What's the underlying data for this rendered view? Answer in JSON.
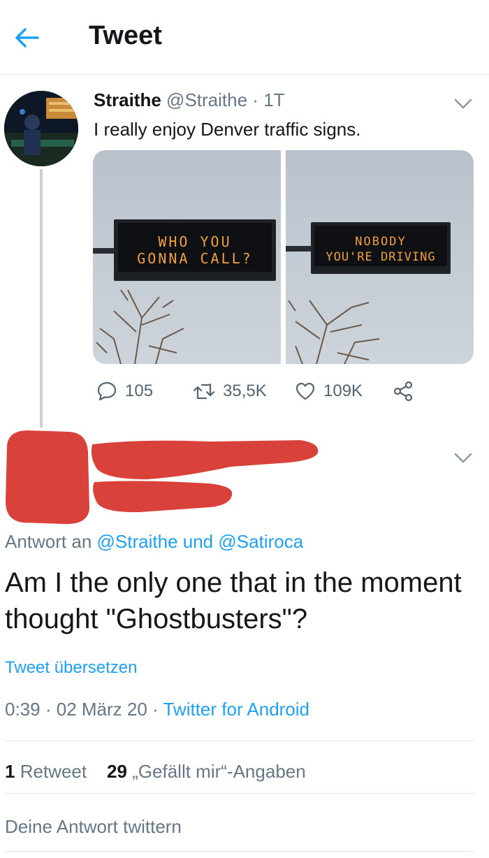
{
  "header": {
    "title": "Tweet"
  },
  "original_tweet": {
    "display_name": "Straithe",
    "handle": "@Straithe",
    "separator": "·",
    "time_ago": "1T",
    "text": "I really enjoy Denver traffic signs.",
    "images": [
      {
        "sign_line1": "WHO YOU",
        "sign_line2": "GONNA CALL?"
      },
      {
        "sign_line1": "NOBODY",
        "sign_line2": "YOU'RE DRIVING"
      }
    ],
    "actions": {
      "replies": "105",
      "retweets": "35,5K",
      "likes": "109K"
    }
  },
  "reply": {
    "reply_to_prefix": "Antwort an",
    "reply_to_user1": "@Straithe",
    "reply_to_joiner": "und",
    "reply_to_user2": "@Satiroca",
    "text": "Am I the only one that in the moment thought \"Ghostbusters\"?",
    "translate": "Tweet übersetzen",
    "time": "0:39",
    "date": "02 März 20",
    "source": "Twitter for Android",
    "retweet_count": "1",
    "retweet_label": "Retweet",
    "like_count": "29",
    "like_label": "„Gefällt mir“-Angaben",
    "compose_placeholder": "Deine Antwort twittern"
  },
  "colors": {
    "accent": "#1da1f2",
    "muted": "#657786",
    "redaction": "#d8423a",
    "sign_text": "#f0a040"
  }
}
